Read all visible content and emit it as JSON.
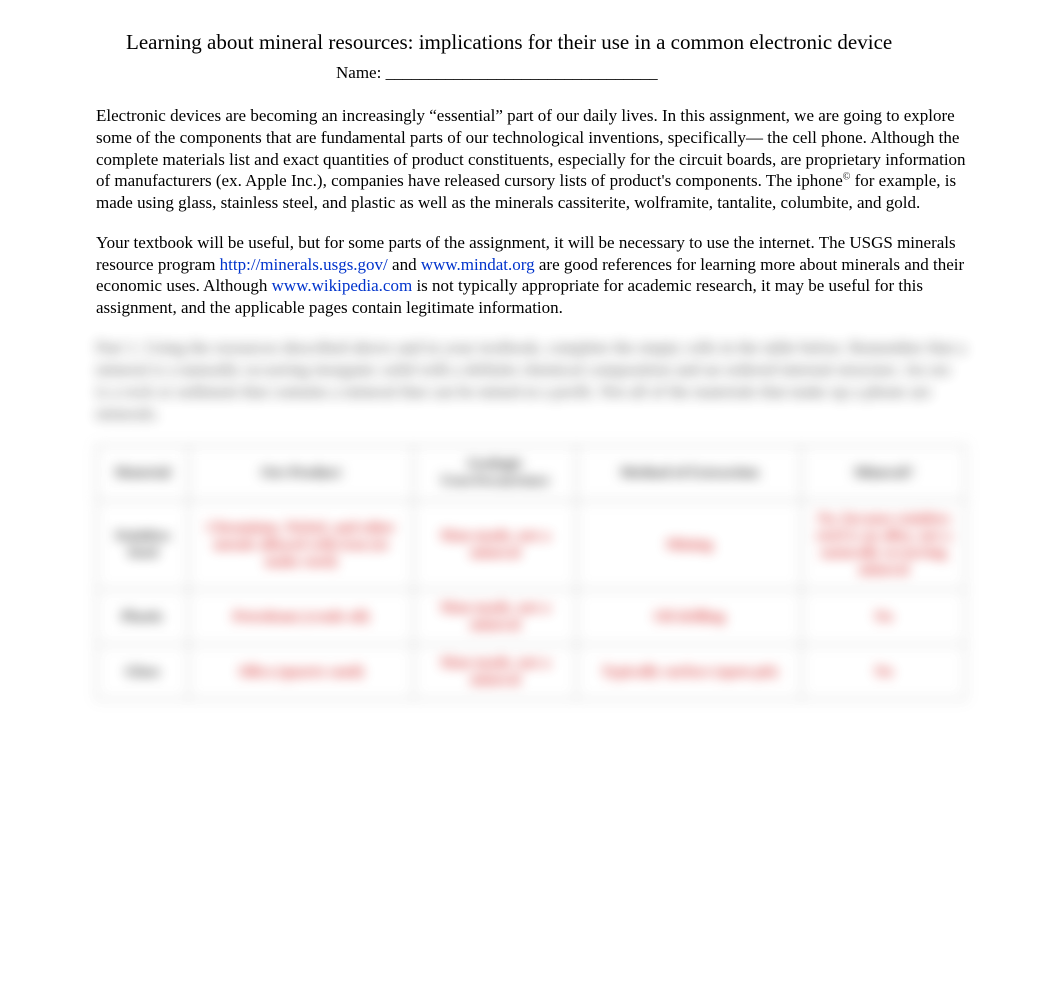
{
  "title": "Learning about mineral resources: implications for their use in a common electronic device",
  "name_label": "Name: ________________________________",
  "para1_a": "Electronic devices are becoming an increasingly “essential” part of our daily lives.  In this assignment, we are going to explore some of the components that are fundamental parts of our technological inventions, specifically— the cell phone.  Although the complete materials list and exact quantities of product constituents, especially for the circuit boards, are proprietary information of manufacturers (ex. Apple Inc.), companies have released cursory lists of product's components. The iphone",
  "copyright": "©",
  "para1_b": " for example, is made using glass, stainless steel, and plastic as well as the minerals cassiterite, wolframite, tantalite, columbite, and gold.",
  "para2_a": "Your textbook will be useful, but for some parts of the assignment, it will be necessary to use the internet.   The USGS minerals resource program ",
  "link1": "http://minerals.usgs.gov/",
  "para2_b": " and ",
  "link2": "www.mindat.org",
  "para2_c": " are good references for learning more about minerals and their economic uses.  Although ",
  "link3": "www.wikipedia.com",
  "para2_d": " is not typically appropriate for academic research, it may be useful for this assignment, and the applicable pages contain legitimate information.",
  "blurred_text": "Part 1. Using the resources described above and in your textbook, complete the empty cells in the table below. Remember that a mineral is a naturally occurring inorganic solid with a definite chemical composition and an ordered internal structure. An ore is a rock or sediment that contains a mineral that can be mined at a profit. Not all of the materials that make up a phone are minerals.",
  "table": {
    "headers": {
      "material": "Material",
      "ore": "Ore Product",
      "occurrence": "Geologic Uses/Occurrence",
      "location": "Method of Extraction",
      "isMineral": "Mineral?"
    },
    "rows": [
      {
        "material": "Stainless Steel",
        "ore": "Chromium, Nickel, and other metals alloyed with iron (to make steel)",
        "occurrence": "Man-made, not a mineral",
        "location": "Mining",
        "isMineral": "No, because stainless steel is an alloy, not a naturally occurring mineral"
      },
      {
        "material": "Plastic",
        "ore": "Petroleum (crude oil)",
        "occurrence": "Man-made, not a mineral",
        "location": "Oil drilling",
        "isMineral": "No"
      },
      {
        "material": "Glass",
        "ore": "Silica (quartz sand)",
        "occurrence": "Man-made, not a mineral",
        "location": "Typically surface (open-pit)",
        "isMineral": "No"
      }
    ]
  }
}
